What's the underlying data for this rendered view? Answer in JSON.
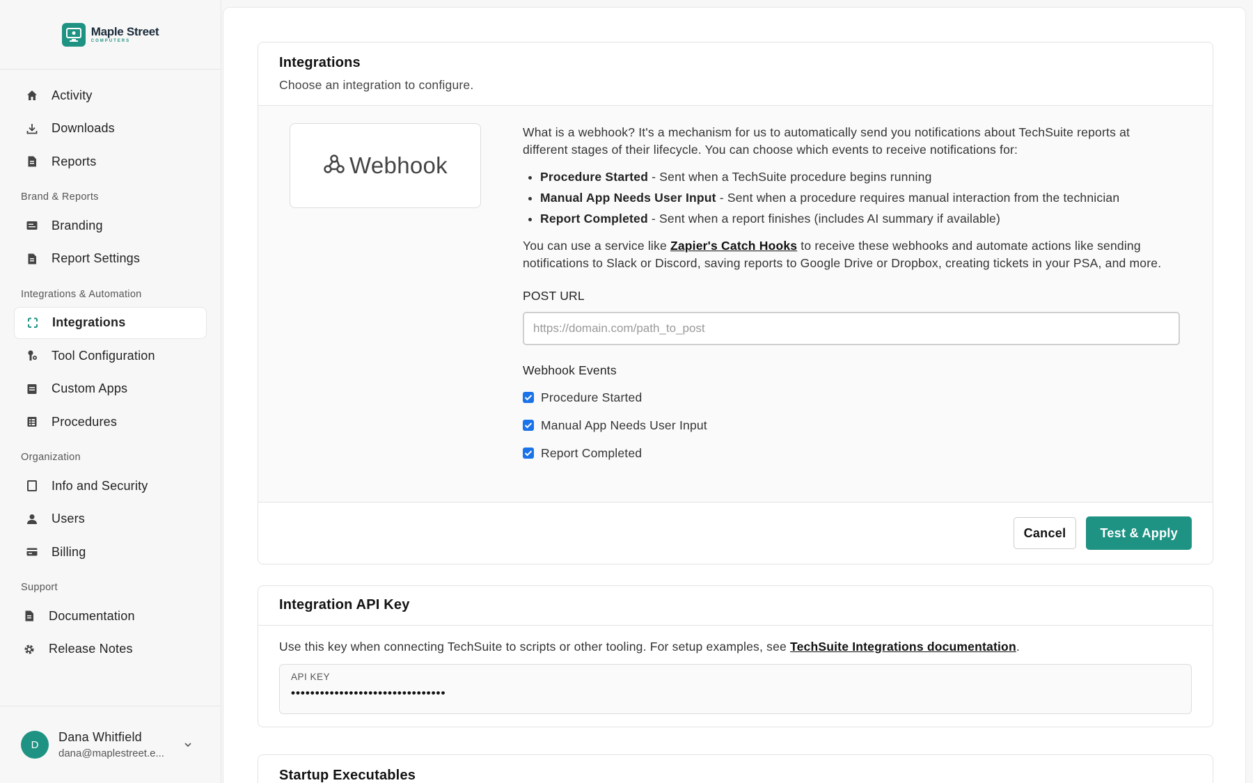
{
  "brand": {
    "name": "Maple Street",
    "sub": "COMPUTERS",
    "color": "#1e9283"
  },
  "sidebar": {
    "items_top": [
      {
        "label": "Activity",
        "icon": "home-icon"
      },
      {
        "label": "Downloads",
        "icon": "download-icon"
      },
      {
        "label": "Reports",
        "icon": "document-icon"
      }
    ],
    "sections": [
      {
        "title": "Brand & Reports",
        "items": [
          {
            "label": "Branding",
            "icon": "card-icon"
          },
          {
            "label": "Report Settings",
            "icon": "document-icon"
          }
        ]
      },
      {
        "title": "Integrations & Automation",
        "items": [
          {
            "label": "Integrations",
            "icon": "sync-icon",
            "active": true
          },
          {
            "label": "Tool Configuration",
            "icon": "tools-icon"
          },
          {
            "label": "Custom Apps",
            "icon": "document-icon"
          },
          {
            "label": "Procedures",
            "icon": "list-icon"
          }
        ]
      },
      {
        "title": "Organization",
        "items": [
          {
            "label": "Info and Security",
            "icon": "square-icon"
          },
          {
            "label": "Users",
            "icon": "user-icon"
          },
          {
            "label": "Billing",
            "icon": "billing-icon"
          }
        ]
      },
      {
        "title": "Support",
        "items": [
          {
            "label": "Documentation",
            "icon": "document-icon"
          },
          {
            "label": "Release Notes",
            "icon": "gear-icon"
          }
        ]
      }
    ]
  },
  "user": {
    "initial": "D",
    "name": "Dana Whitfield",
    "email": "dana@maplestreet.e..."
  },
  "integrations": {
    "title": "Integrations",
    "subtitle": "Choose an integration to configure.",
    "tile_label": "Webhook",
    "intro": "What is a webhook? It's a mechanism for us to automatically send you notifications about TechSuite reports at different stages of their lifecycle. You can choose which events to receive notifications for:",
    "bullets": [
      {
        "name": "Procedure Started",
        "desc": " - Sent when a TechSuite procedure begins running"
      },
      {
        "name": "Manual App Needs User Input",
        "desc": " - Sent when a procedure requires manual interaction from the technician"
      },
      {
        "name": "Report Completed",
        "desc": " - Sent when a report finishes (includes AI summary if available)"
      }
    ],
    "service_pre": "You can use a service like ",
    "service_link": "Zapier's Catch Hooks",
    "service_post": " to receive these webhooks and automate actions like sending notifications to Slack or Discord, saving reports to Google Drive or Dropbox, creating tickets in your PSA, and more.",
    "post_url_label": "POST URL",
    "post_url_value": "",
    "post_url_placeholder": "https://domain.com/path_to_post",
    "events_label": "Webhook Events",
    "events": [
      {
        "label": "Procedure Started",
        "checked": true
      },
      {
        "label": "Manual App Needs User Input",
        "checked": true
      },
      {
        "label": "Report Completed",
        "checked": true
      }
    ],
    "cancel_label": "Cancel",
    "apply_label": "Test & Apply"
  },
  "api_key": {
    "title": "Integration API Key",
    "desc_pre": "Use this key when connecting TechSuite to scripts or other tooling. For setup examples, see ",
    "desc_link": "TechSuite Integrations documentation",
    "desc_post": ".",
    "label": "API KEY",
    "value": "••••••••••••••••••••••••••••••••"
  },
  "startup": {
    "title": "Startup Executables"
  }
}
